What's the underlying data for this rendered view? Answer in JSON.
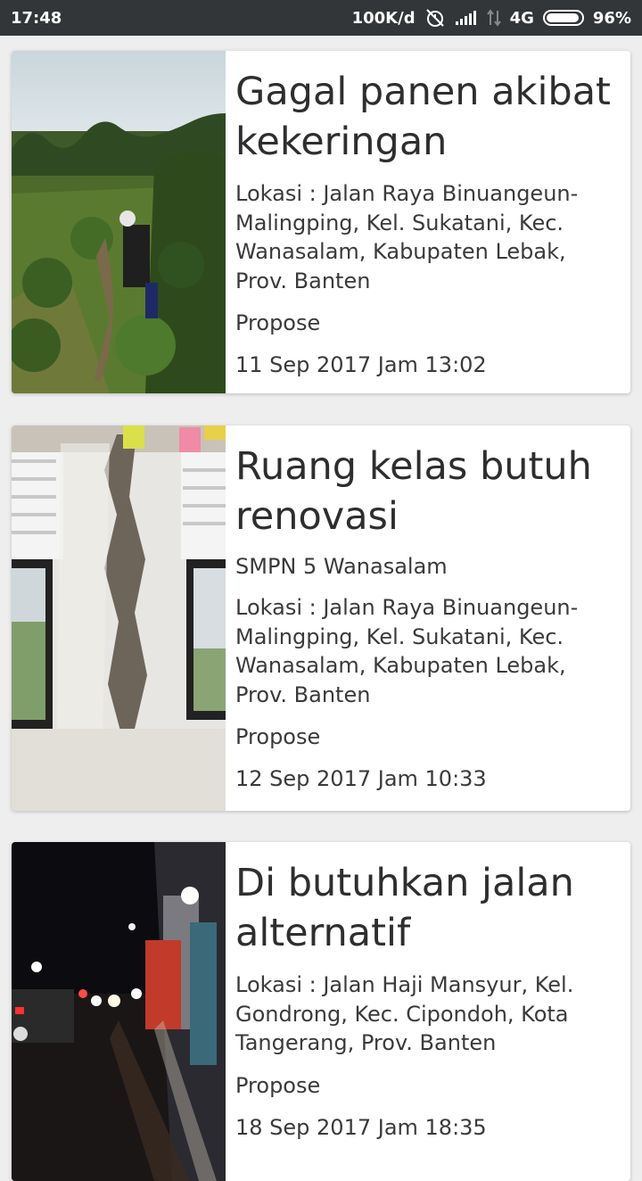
{
  "status_bar": {
    "time": "17:48",
    "speed": "100K/d",
    "network": "4G",
    "battery": "96%",
    "battery_level": 0.96
  },
  "items": [
    {
      "title": "Gagal panen akibat kekeringan",
      "subtitle": "",
      "location": "Lokasi : Jalan Raya Binuangeun-Malingping, Kel. Sukatani, Kec. Wanasalam, Kabupaten Lebak, Prov. Banten",
      "status": "Propose",
      "date": "11 Sep 2017 Jam 13:02",
      "image_icon": "farm-field-photo"
    },
    {
      "title": "Ruang kelas butuh renovasi",
      "subtitle": "SMPN 5 Wanasalam",
      "location": "Lokasi : Jalan Raya Binuangeun-Malingping, Kel. Sukatani, Kec. Wanasalam, Kabupaten Lebak, Prov. Banten",
      "status": "Propose",
      "date": "12 Sep 2017 Jam 10:33",
      "image_icon": "cracked-wall-photo"
    },
    {
      "title": "Di butuhkan jalan alternatif",
      "subtitle": "",
      "location": "Lokasi : Jalan Haji Mansyur, Kel. Gondrong, Kec. Cipondoh, Kota Tangerang, Prov. Banten",
      "status": "Propose",
      "date": "18 Sep 2017 Jam 18:35",
      "image_icon": "night-street-photo"
    }
  ]
}
